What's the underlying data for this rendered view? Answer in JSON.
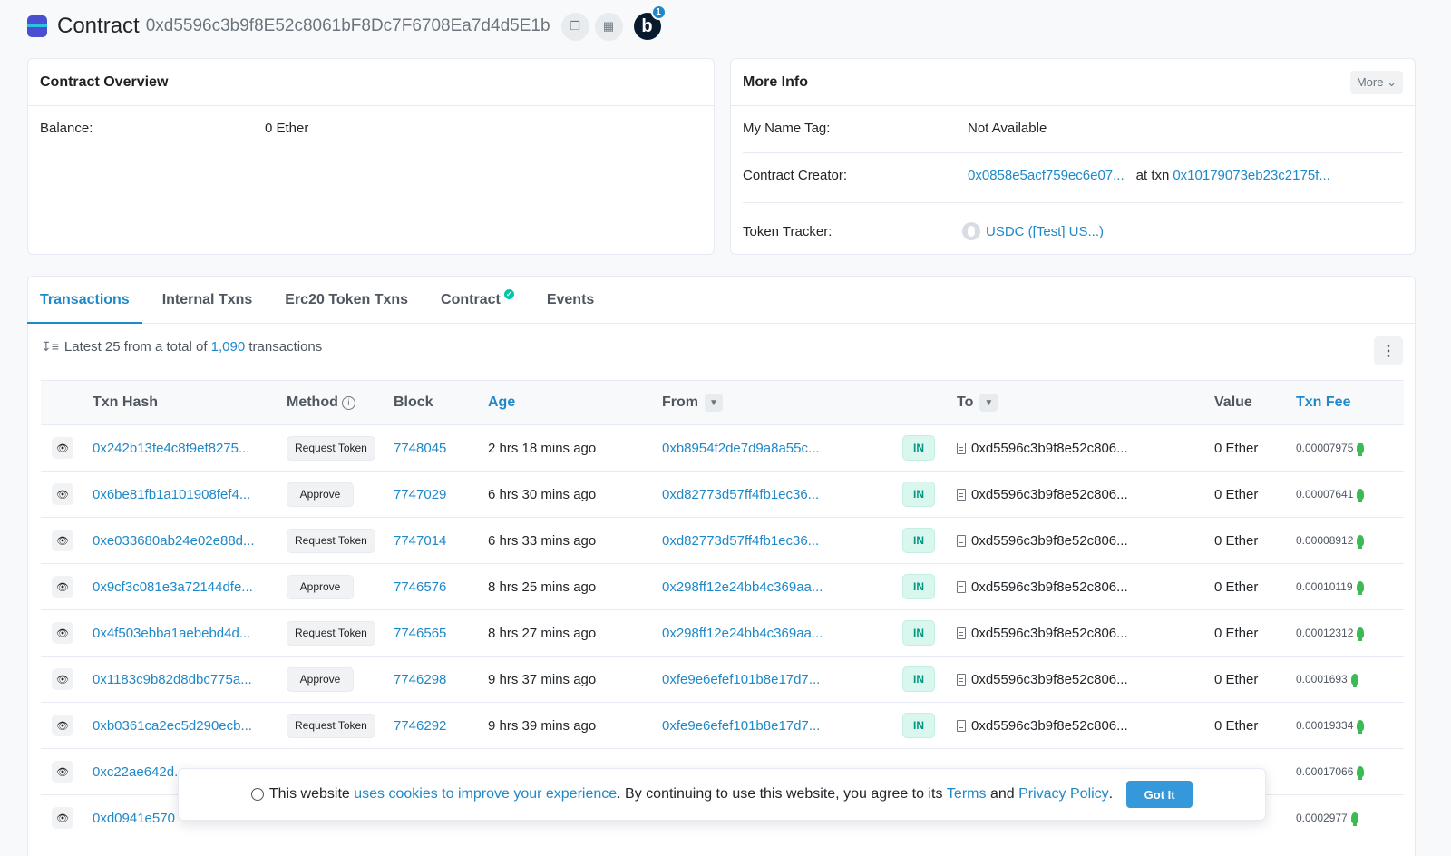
{
  "header": {
    "title": "Contract",
    "address": "0xd5596c3b9f8E52c8061bF8Dc7F6708Ea7d4d5E1b",
    "avatar_letter": "b",
    "notification_count": "1"
  },
  "overview": {
    "title": "Contract Overview",
    "balance_label": "Balance:",
    "balance_value": "0 Ether"
  },
  "more_info": {
    "title": "More Info",
    "more_label": "More",
    "name_tag_label": "My Name Tag:",
    "name_tag_value": "Not Available",
    "creator_label": "Contract Creator:",
    "creator_address": "0x0858e5acf759ec6e07...",
    "at_txn_label": "at txn",
    "creator_txn": "0x10179073eb23c2175f...",
    "token_tracker_label": "Token Tracker:",
    "token_tracker_value": "USDC ([Test] US...)"
  },
  "tabs": [
    {
      "label": "Transactions"
    },
    {
      "label": "Internal Txns"
    },
    {
      "label": "Erc20 Token Txns"
    },
    {
      "label": "Contract"
    },
    {
      "label": "Events"
    }
  ],
  "summary": {
    "prefix": "Latest 25 from a total of",
    "total": "1,090",
    "suffix": "transactions"
  },
  "table": {
    "columns": {
      "hash": "Txn Hash",
      "method": "Method",
      "block": "Block",
      "age": "Age",
      "from": "From",
      "to": "To",
      "value": "Value",
      "fee": "Txn Fee"
    },
    "rows": [
      {
        "hash": "0x242b13fe4c8f9ef8275...",
        "method": "Request Token",
        "block": "7748045",
        "age": "2 hrs 18 mins ago",
        "from": "0xb8954f2de7d9a8a55c...",
        "dir": "IN",
        "to": "0xd5596c3b9f8e52c806...",
        "value": "0 Ether",
        "fee": "0.00007975"
      },
      {
        "hash": "0x6be81fb1a101908fef4...",
        "method": "Approve",
        "block": "7747029",
        "age": "6 hrs 30 mins ago",
        "from": "0xd82773d57ff4fb1ec36...",
        "dir": "IN",
        "to": "0xd5596c3b9f8e52c806...",
        "value": "0 Ether",
        "fee": "0.00007641"
      },
      {
        "hash": "0xe033680ab24e02e88d...",
        "method": "Request Token",
        "block": "7747014",
        "age": "6 hrs 33 mins ago",
        "from": "0xd82773d57ff4fb1ec36...",
        "dir": "IN",
        "to": "0xd5596c3b9f8e52c806...",
        "value": "0 Ether",
        "fee": "0.00008912"
      },
      {
        "hash": "0x9cf3c081e3a72144dfe...",
        "method": "Approve",
        "block": "7746576",
        "age": "8 hrs 25 mins ago",
        "from": "0x298ff12e24bb4c369aa...",
        "dir": "IN",
        "to": "0xd5596c3b9f8e52c806...",
        "value": "0 Ether",
        "fee": "0.00010119"
      },
      {
        "hash": "0x4f503ebba1aebebd4d...",
        "method": "Request Token",
        "block": "7746565",
        "age": "8 hrs 27 mins ago",
        "from": "0x298ff12e24bb4c369aa...",
        "dir": "IN",
        "to": "0xd5596c3b9f8e52c806...",
        "value": "0 Ether",
        "fee": "0.00012312"
      },
      {
        "hash": "0x1183c9b82d8dbc775a...",
        "method": "Approve",
        "block": "7746298",
        "age": "9 hrs 37 mins ago",
        "from": "0xfe9e6efef101b8e17d7...",
        "dir": "IN",
        "to": "0xd5596c3b9f8e52c806...",
        "value": "0 Ether",
        "fee": "0.0001693"
      },
      {
        "hash": "0xb0361ca2ec5d290ecb...",
        "method": "Request Token",
        "block": "7746292",
        "age": "9 hrs 39 mins ago",
        "from": "0xfe9e6efef101b8e17d7...",
        "dir": "IN",
        "to": "0xd5596c3b9f8e52c806...",
        "value": "0 Ether",
        "fee": "0.00019334"
      },
      {
        "hash": "0xc22ae642d...",
        "method": "",
        "block": "",
        "age": "",
        "from": "",
        "dir": "",
        "to": "",
        "value": "",
        "fee": "0.00017066"
      },
      {
        "hash": "0xd0941e570",
        "method": "",
        "block": "",
        "age": "",
        "from": "",
        "dir": "",
        "to": "",
        "value": "",
        "fee": "0.0002977"
      }
    ]
  },
  "cookie": {
    "text_1": "This website",
    "link_1": "uses cookies to improve your experience",
    "text_2": ". By continuing to use this website, you agree to its",
    "terms": "Terms",
    "and": "and",
    "privacy": "Privacy Policy",
    "period": ".",
    "button": "Got It"
  },
  "icons": {
    "copy": "copy-icon",
    "qr": "qr-code-icon",
    "eye": "eye-icon",
    "filter": "filter-icon",
    "info": "info-icon",
    "doc": "contract-doc-icon",
    "bulb": "gas-bulb-icon",
    "cookie": "cookie-icon",
    "sort": "sort-icon",
    "kebab": "more-vertical-icon"
  },
  "colors": {
    "link": "#1e88c8",
    "in_badge_bg": "#d9f6ef",
    "in_badge_text": "#02977e",
    "verified": "#00c9a7",
    "button": "#3498db"
  }
}
